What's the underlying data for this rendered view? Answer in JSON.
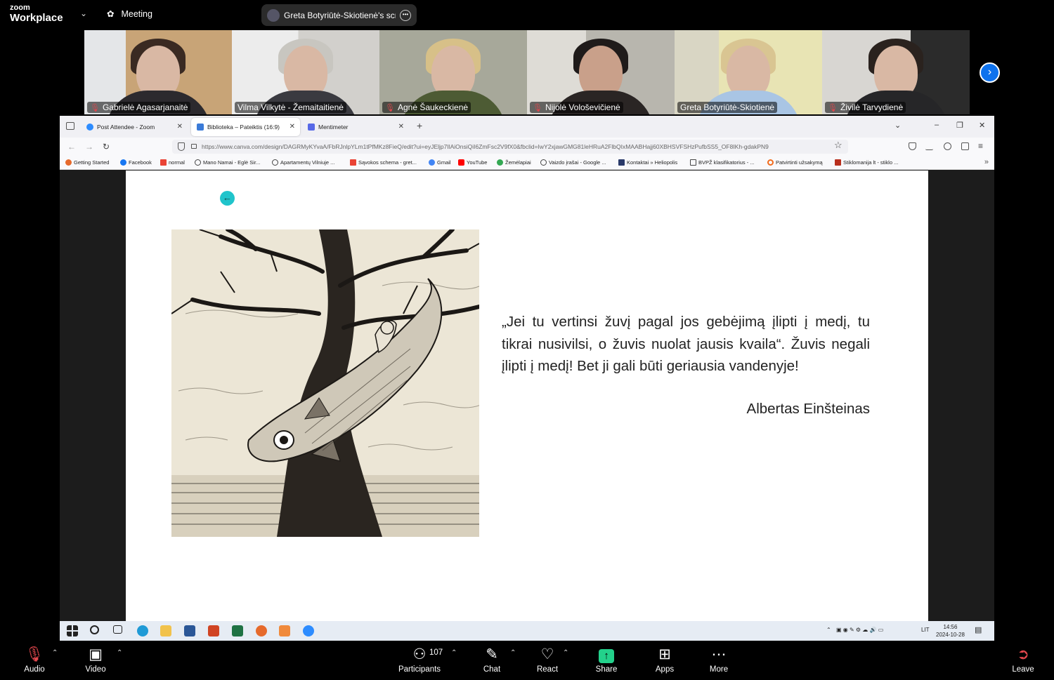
{
  "app": {
    "logo_line1": "zoom",
    "logo_line2": "Workplace",
    "meeting_label": "Meeting",
    "share_banner": "Greta Botyriūtė-Skiotienė's screen"
  },
  "participants": [
    {
      "name": "Gabrielė Agasarjanaitė",
      "muted": true
    },
    {
      "name": "Vilma Vilkytė - Žemaitaitienė",
      "muted": false
    },
    {
      "name": "Agnė Šaukeckienė",
      "muted": true
    },
    {
      "name": "Nijolė Vološevičienė",
      "muted": true
    },
    {
      "name": "Greta Botyriūtė-Skiotienė",
      "muted": false,
      "active": true
    },
    {
      "name": "Živilė Tarvydienė",
      "muted": true
    }
  ],
  "browser": {
    "tabs": [
      {
        "label": "Post Attendee - Zoom",
        "active": false
      },
      {
        "label": "Biblioteka – Pateiktis (16:9)",
        "active": true
      },
      {
        "label": "Mentimeter",
        "active": false
      }
    ],
    "url": "https://www.canva.com/design/DAGRMyKYvaA/FbRJnlpYLm1tPfMKz8FieQ/edit?ui=eyJEljp7IlAiOnsiQiI6ZmFsc2V9fX0&fbclid=IwY2xjawGMG81leHRuA2FlbQIxMAABHajj60XBHSVFSHzPufbSS5_OF8IKh-gdakPN9",
    "bookmarks": [
      "Getting Started",
      "Facebook",
      "normal",
      "Mano Namai - Eglė Sir...",
      "Apartamentų Vilniuje ...",
      "Sąvokos schema - gret...",
      "Gmail",
      "YouTube",
      "Žemėlapiai",
      "Vaizdo įrašai - Google ...",
      "Kontaktai » Heliopolis",
      "BVPŽ klasifikatorius - ...",
      "Patvirtinti užsakymą",
      "Stiklomanija lt - stiklo ..."
    ]
  },
  "slide": {
    "quote": "„Jei tu vertinsi žuvį pagal jos gebėjimą įlipti į medį, tu tikrai nusivilsi, o žuvis nuolat jausis kvaila“. Žuvis negali įlipti į medį! Bet ji gali būti geriausia vandenyje!",
    "author": "Albertas Einšteinas"
  },
  "taskbar": {
    "lang": "LIT",
    "time": "14:56",
    "date": "2024-10-28"
  },
  "toolbar": {
    "audio": "Audio",
    "video": "Video",
    "participants": "Participants",
    "participant_count": "107",
    "chat": "Chat",
    "react": "React",
    "share": "Share",
    "apps": "Apps",
    "more": "More",
    "leave": "Leave"
  }
}
